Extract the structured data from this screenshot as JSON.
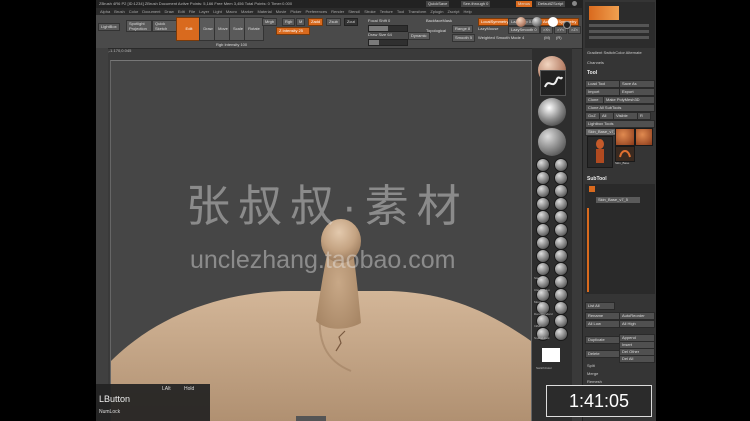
{
  "app": {
    "title_text": "ZBrush 4R6 P2 [ID:1234] ZBrush Document    Active Points: 5,166   Free Mem 3,456   Total Points: 0   Timer:0.000",
    "quicksave": "QuickSave",
    "see_through": "See-through 0",
    "menus": "Menus",
    "default_script": "DefaultZScript"
  },
  "menubar": [
    "Alpha",
    "Brush",
    "Color",
    "Document",
    "Draw",
    "Edit",
    "File",
    "Layer",
    "Light",
    "Macro",
    "Marker",
    "Material",
    "Movie",
    "Picker",
    "Preferences",
    "Render",
    "Stencil",
    "Stroke",
    "Texture",
    "Tool",
    "Transform",
    "Zplugin",
    "Zscript",
    "Help"
  ],
  "toolbar": {
    "lightbox": "LightBox",
    "spotlight": "Spotlight Projection",
    "quick_sketch": "Quick Sketch",
    "edit": "Edit",
    "draw": "Draw",
    "move": "Move",
    "scale": "Scale",
    "rotate": "Rotate",
    "mrgb": "Mrgb",
    "rgb": "Rgb",
    "m": "M",
    "zadd": "Zadd",
    "zsub": "Zsub",
    "zcut": "Zcut",
    "rgb_intensity": "Rgb Intensity 100",
    "z_intensity": "Z Intensity 25",
    "focal_shift": "Focal Shift 0",
    "draw_size": "Draw Size 64",
    "dynamic": "Dynamic",
    "backface": "BackfaceMask",
    "topological": "Topological",
    "range": "Range 8",
    "smooth": "Smooth 5",
    "local_sym": "LocalSymmetry",
    "lazymouse": "LazyMouse",
    "lazystep": "LazyStep 0.6",
    "lazysmooth": "LazySmooth 0",
    "lazy_radius": "LazyRadius 1",
    "activate_symmetry": "Activate Symmetry",
    "weighted_smooth": "Weighted Smooth Mode 4",
    "x": ">X<",
    "y": ">Y<",
    "z": ">Z<",
    "m_btn": "(M)",
    "r": "(R)",
    "radial_count": "RadialCount"
  },
  "coords": "0.411,-1.170,0.045",
  "shelf": {
    "labels": [
      "Standard",
      "ClayBuildup",
      "Move",
      "DamStandard",
      "Inflat",
      "SnakeHook",
      "hPolish",
      "TrimDynamic",
      "Pinch",
      "Slash3",
      "CurveTube",
      "Alpha Off",
      "Texture Off",
      "MatCap Red"
    ],
    "switch_color": "SwitchColor",
    "gradient": "Gradient"
  },
  "palette": {
    "header_extra": "Gradient   SwitchColor   Alternate",
    "channels": "Channels",
    "tool_title": "Tool",
    "load_tool": "Load Tool",
    "save_as": "Save As",
    "import": "Import",
    "export": "Export",
    "clone": "Clone",
    "make_polymesh": "Make PolyMesh3D",
    "clone_all": "Clone All SubTools",
    "goz": "GoZ",
    "all": "All",
    "visible": "Visible",
    "r": "R",
    "lightbox_tools": "Lightbox Tools",
    "current_tool": "Skin_Base_v7_5 48",
    "subtool_thumbs": [
      "Skin_Base",
      "PolyMesh",
      "SimpleBrush",
      "Skin_Base"
    ],
    "subtool": "SubTool",
    "subtool_items": [
      "Skin_Base_v7_5"
    ],
    "list_all": "List All",
    "rename": "Rename",
    "autoreorder": "AutoReorder",
    "all_low": "All Low",
    "all_high": "All High",
    "duplicate": "Duplicate",
    "append": "Append",
    "insert": "Insert",
    "delete": "Delete",
    "del_other": "Del Other",
    "del_all": "Del All",
    "split": "Split",
    "merge": "Merge",
    "remesh": "Remesh"
  },
  "overlay": {
    "lbutton": "LButton",
    "lalt": "LAlt",
    "hold": "Hold",
    "numlock": "NumLock",
    "timer": "1:41:05"
  },
  "watermark": {
    "cn": "张叔叔·素材",
    "en": "unclezhang.taobao.com"
  },
  "colors": {
    "accent": "#d96a1e",
    "skin": "#c4a382",
    "canvas": "#464646"
  }
}
